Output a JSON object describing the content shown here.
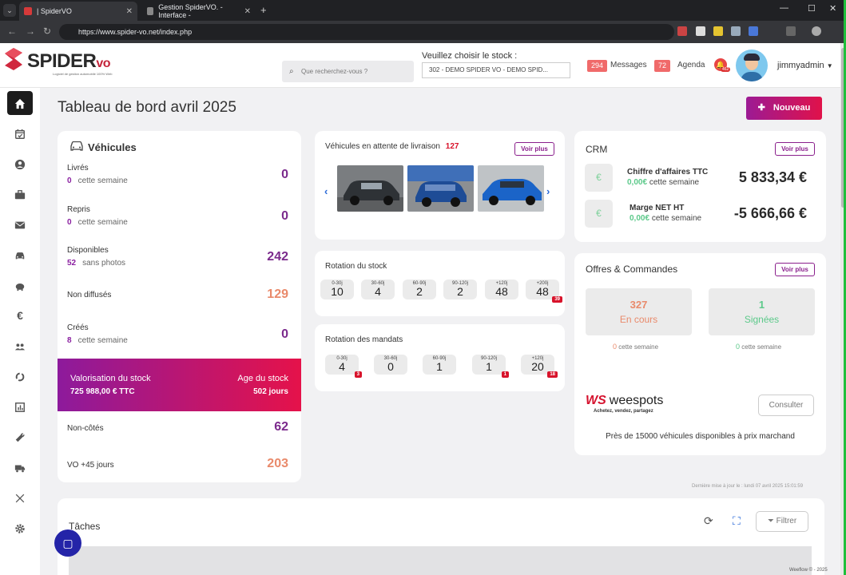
{
  "browser": {
    "tabs": [
      {
        "label": "| SpiderVO"
      },
      {
        "label": "Gestion SpiderVO. - Interface - "
      }
    ],
    "url": "https://www.spider-vo.net/index.php"
  },
  "header": {
    "logo_text": "SPIDER",
    "logo_suffix": "vo",
    "logo_tagline": "Logiciel de gestion automobile 100% Web",
    "search_placeholder": "Que recherchez-vous ?",
    "stock_label": "Veuillez choisir le stock :",
    "stock_value": "302 - DEMO SPIDER VO - DEMO SPID...",
    "messages_count": "294",
    "messages_label": "Messages",
    "agenda_count": "72",
    "agenda_label": "Agenda",
    "notif_count": "462",
    "username": "jimmyadmin"
  },
  "sidebar": {
    "items": [
      "home-icon",
      "tasks-icon",
      "user-icon",
      "briefcase-icon",
      "mail-icon",
      "car-icon",
      "piggy-bank-icon",
      "euro-icon",
      "users-icon",
      "refresh-icon",
      "chart-icon",
      "wrench-icon",
      "truck-icon",
      "tools-icon",
      "settings-icon"
    ]
  },
  "page": {
    "title": "Tableau de bord avril 2025",
    "new_button": "Nouveau"
  },
  "vehicules": {
    "title": "Véhicules",
    "rows": [
      {
        "label": "Livrés",
        "sub_count": "0",
        "sub_text": "cette semaine",
        "value": "0"
      },
      {
        "label": "Repris",
        "sub_count": "0",
        "sub_text": "cette semaine",
        "value": "0"
      },
      {
        "label": "Disponibles",
        "sub_count": "52",
        "sub_text": "sans photos",
        "value": "242"
      },
      {
        "label": "Non diffusés",
        "value": "129"
      },
      {
        "label": "Créés",
        "sub_count": "8",
        "sub_text": "cette semaine",
        "value": "0"
      }
    ],
    "valorisation_label": "Valorisation du stock",
    "valorisation_value": "725 988,00 € TTC",
    "age_label": "Age du stock",
    "age_value": "502 jours",
    "non_cotes_label": "Non-côtés",
    "non_cotes_value": "62",
    "vo45_label": "VO +45 jours",
    "vo45_value": "203"
  },
  "livraison": {
    "title": "Véhicules en attente de livraison",
    "count": "127",
    "voir_plus": "Voir plus"
  },
  "rotation_stock": {
    "title": "Rotation du stock",
    "items": [
      {
        "label": "0-30j",
        "value": "10"
      },
      {
        "label": "30-60j",
        "value": "4"
      },
      {
        "label": "60-90j",
        "value": "2"
      },
      {
        "label": "90-120j",
        "value": "2"
      },
      {
        "label": "+120j",
        "value": "48"
      },
      {
        "label": "+200j",
        "value": "48",
        "badge": "39"
      }
    ]
  },
  "rotation_mandats": {
    "title": "Rotation des mandats",
    "items": [
      {
        "label": "0-30j",
        "value": "4",
        "badge": "3"
      },
      {
        "label": "30-60j",
        "value": "0"
      },
      {
        "label": "60-90j",
        "value": "1"
      },
      {
        "label": "90-120j",
        "value": "1",
        "badge": "1"
      },
      {
        "label": "+120j",
        "value": "20",
        "badge": "18"
      }
    ]
  },
  "crm": {
    "title": "CRM",
    "voir_plus": "Voir plus",
    "ca_label": "Chiffre d'affaires TTC",
    "ca_sub_value": "0,00€",
    "ca_sub_text": "cette semaine",
    "ca_value": "5 833,34 €",
    "marge_label": "Marge NET HT",
    "marge_sub_value": "0,00€",
    "marge_sub_text": "cette semaine",
    "marge_value": "-5 666,66 €",
    "euro_symbol": "€"
  },
  "offres": {
    "title": "Offres & Commandes",
    "voir_plus": "Voir plus",
    "en_cours_value": "327",
    "en_cours_label": "En cours",
    "en_cours_week": "0",
    "signees_value": "1",
    "signees_label": "Signées",
    "signees_week": "0",
    "week_text": "cette semaine"
  },
  "weespots": {
    "logo_mark": "WS",
    "logo_text": "weespots",
    "tagline": "Achetez, vendez, partagez",
    "consult_button": "Consulter",
    "text": "Près de 15000 véhicules disponibles à prix marchand"
  },
  "last_update": "Dernière mise à jour le : lundi 07 avril 2025 15:01:59",
  "taches": {
    "title": "Tâches",
    "filter_button": "Filtrer"
  },
  "footer": "Weeflow © - 2025",
  "colors": {
    "accent_start": "#9c1a94",
    "accent_end": "#e0124a",
    "purple": "#7b2a8c",
    "orange": "#e98a6b",
    "green": "#5cc98a"
  }
}
